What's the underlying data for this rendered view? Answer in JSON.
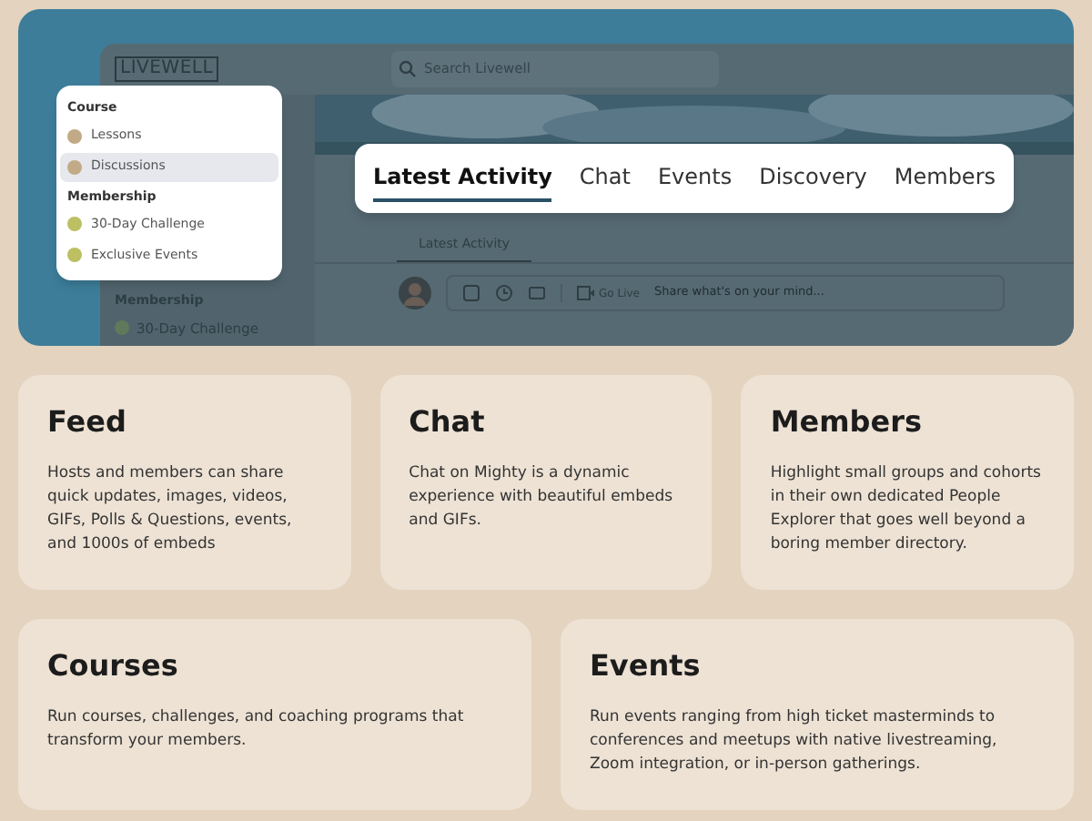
{
  "app_preview": {
    "logo": "LIVEWELL",
    "search": {
      "placeholder": "Search Livewell"
    },
    "sidebar": {
      "section": "Membership",
      "items": [
        {
          "label": "30-Day Challenge",
          "color": "#5f7a5a"
        }
      ]
    },
    "tabs": [
      {
        "label": "Latest Activity",
        "selected": true
      }
    ],
    "composer": {
      "go_live": "Go Live",
      "placeholder": "Share what's on your mind..."
    }
  },
  "menu": {
    "sections": [
      {
        "title": "Course",
        "items": [
          {
            "label": "Lessons",
            "color": "#c2aa86",
            "selected": false
          },
          {
            "label": "Discussions",
            "color": "#c2aa86",
            "selected": true
          }
        ]
      },
      {
        "title": "Membership",
        "items": [
          {
            "label": "30-Day Challenge",
            "color": "#bcbf62",
            "selected": false
          },
          {
            "label": "Exclusive Events",
            "color": "#bcbf62",
            "selected": false
          }
        ]
      }
    ]
  },
  "nav_tabs": [
    {
      "label": "Latest Activity",
      "selected": true
    },
    {
      "label": "Chat",
      "selected": false
    },
    {
      "label": "Events",
      "selected": false
    },
    {
      "label": "Discovery",
      "selected": false
    },
    {
      "label": "Members",
      "selected": false
    }
  ],
  "features": [
    {
      "title": "Feed",
      "text": "Hosts and members can share quick updates, images, videos, GIFs, Polls & Questions, events, and 1000s of embeds"
    },
    {
      "title": "Chat",
      "text": "Chat on Mighty is a dynamic experience with beautiful embeds and GIFs."
    },
    {
      "title": "Members",
      "text": "Highlight small groups and cohorts in their own dedicated People Explorer that goes well beyond a boring member directory."
    },
    {
      "title": "Courses",
      "text": "Run courses, challenges, and coaching programs that transform your members."
    },
    {
      "title": "Events",
      "text": "Run events ranging from high ticket masterminds to conferences and meetups with native livestreaming, Zoom integration, or in-person gatherings."
    }
  ]
}
